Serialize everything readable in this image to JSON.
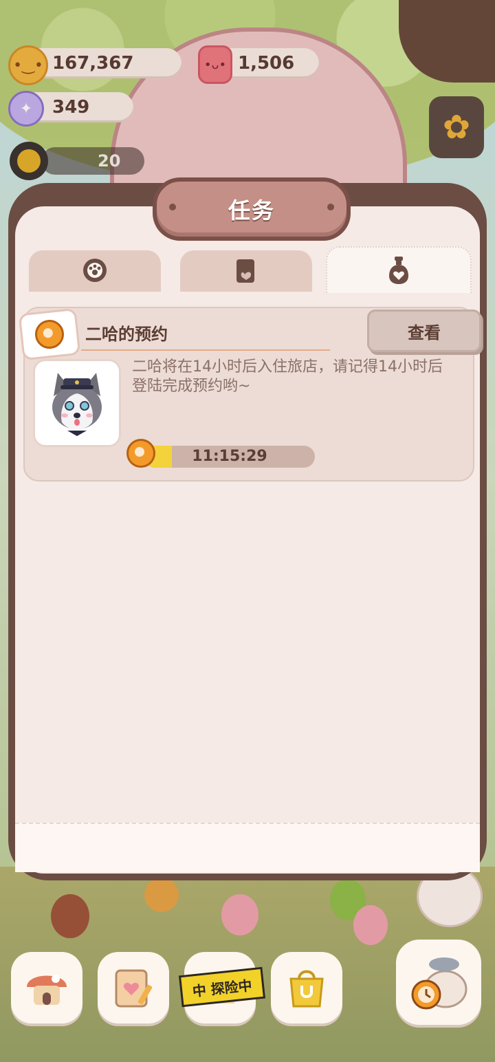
{
  "resources": {
    "cookies": {
      "value": "167,367",
      "icon": "cookie-coin-icon"
    },
    "jelly": {
      "value": "1,506",
      "icon": "jelly-icon"
    },
    "crystals": {
      "value": "349",
      "icon": "crystal-candy-icon"
    },
    "level": {
      "value": "20",
      "icon": "sun-level-icon"
    }
  },
  "modal": {
    "title": "任务",
    "tabs": [
      {
        "icon": "paw-badge-icon",
        "active": false
      },
      {
        "icon": "scroll-note-icon",
        "active": false
      },
      {
        "icon": "bell-heart-icon",
        "active": true
      }
    ],
    "task": {
      "badge_icon": "alarm-clock-icon",
      "title": "二哈的预约",
      "view_button": "查看",
      "avatar": "husky-avatar",
      "description": "二哈将在14小时后入住旅店，请记得14小时后登陆完成预约哟~",
      "timer": "11:15:29",
      "progress_fraction": 0.16
    }
  },
  "bottom_nav": {
    "items": [
      {
        "icon": "mushroom-house-icon"
      },
      {
        "icon": "notebook-heart-icon"
      },
      {
        "icon": "explore-sign-icon",
        "label": "中 探险中"
      },
      {
        "icon": "shop-bag-icon"
      },
      {
        "icon": "alarm-cat-icon"
      }
    ]
  },
  "colors": {
    "panel_frame": "#6b4d44",
    "panel_bg": "#f5eae5",
    "accent_yellow": "#f4d23c",
    "text_dark": "#5b3d33",
    "text_muted": "#8a7068"
  }
}
